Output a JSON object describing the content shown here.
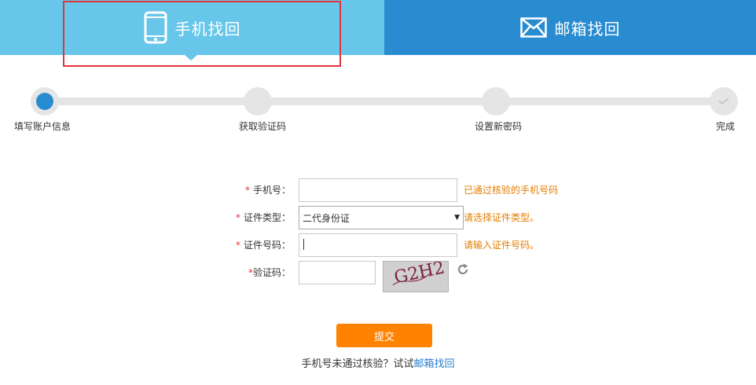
{
  "tabs": {
    "phone": {
      "label": "手机找回",
      "icon": "phone-icon"
    },
    "email": {
      "label": "邮箱找回",
      "icon": "envelope-icon"
    }
  },
  "steps": [
    {
      "label": "填写账户信息",
      "state": "active"
    },
    {
      "label": "获取验证码",
      "state": "pending"
    },
    {
      "label": "设置新密码",
      "state": "pending"
    },
    {
      "label": "完成",
      "state": "pending",
      "icon": "check-icon"
    }
  ],
  "form": {
    "phone": {
      "label": "手机号：",
      "value": "",
      "hint": "已通过核验的手机号码"
    },
    "id_type": {
      "label": "证件类型：",
      "value": "二代身份证",
      "hint": "请选择证件类型。"
    },
    "id_number": {
      "label": "证件号码：",
      "value": "",
      "hint": "请输入证件号码。"
    },
    "captcha": {
      "label": "验证码：",
      "value": "",
      "image_text": "G2H2",
      "refresh_icon": "refresh-icon"
    }
  },
  "submit_label": "提交",
  "alt": {
    "text": "手机号未通过核验？试试",
    "link": "邮箱找回"
  },
  "colors": {
    "phone_tab": "#67c6ea",
    "email_tab": "#2a8cd0",
    "accent": "#2a8cd0",
    "hint": "#e67e00",
    "submit": "#ff8200",
    "required": "#e0353c",
    "highlight": "#e0353c"
  }
}
